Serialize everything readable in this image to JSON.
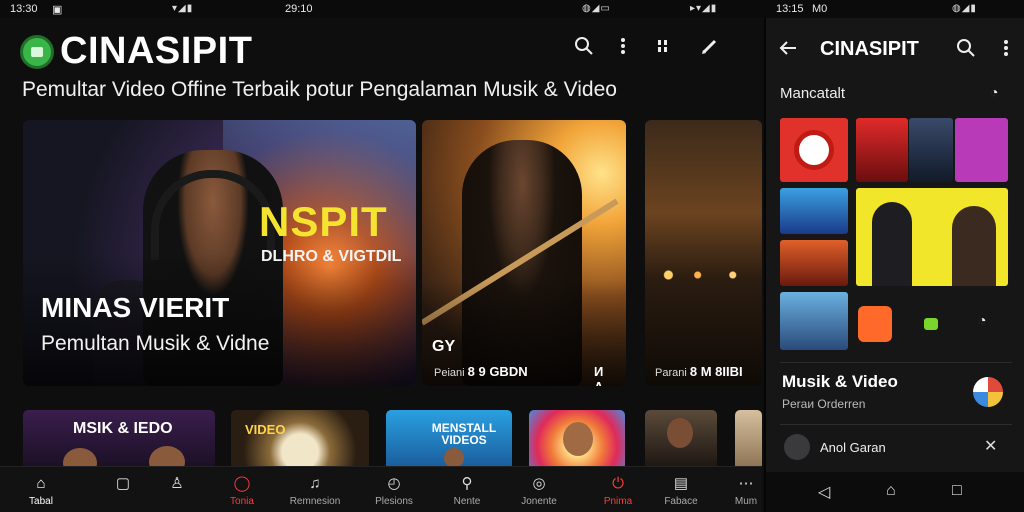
{
  "status_bar": {
    "left_time": "13:30",
    "mid_time": "29:10",
    "right_time": "13:15",
    "right_label": "M0"
  },
  "header": {
    "app_name": "CINASIPIT",
    "subtitle": "Pemultar Video Offine Terbaik potur Pengalaman Musik & Video",
    "icons": [
      "search-icon",
      "more-vert-icon",
      "grid-icon",
      "edit-icon"
    ]
  },
  "featured": [
    {
      "overlay_big": "NSPIT",
      "overlay_small": "DLHRO & VIGTDIL",
      "title": "MINAS VIERIT",
      "subtitle": "Pemultan Musik & Vidne"
    },
    {
      "tag": "GY",
      "foot_label": "Peiani",
      "foot_bold": "8 9 GBDN",
      "foot_right": "И A"
    },
    {
      "foot_label": "Parani",
      "foot_bold": "8 M 8IIBI"
    }
  ],
  "thumbnails": [
    {
      "label": "MSIK & IEDO"
    },
    {
      "label": "VIDEO"
    },
    {
      "label": "MENSTALL VIDEOS"
    },
    {
      "label": ""
    },
    {
      "label": ""
    },
    {
      "label": ""
    }
  ],
  "bottom_nav": [
    {
      "label": "Tabal",
      "icon": "home-icon",
      "state": "active"
    },
    {
      "label": "",
      "icon": "chat-icon",
      "state": "normal"
    },
    {
      "label": "",
      "icon": "profile-icon",
      "state": "normal"
    },
    {
      "label": "Tonia",
      "icon": "search-icon",
      "state": "red"
    },
    {
      "label": "Remnesion",
      "icon": "music-icon",
      "state": "normal"
    },
    {
      "label": "Plesions",
      "icon": "clock-icon",
      "state": "normal"
    },
    {
      "label": "Nente",
      "icon": "search-icon",
      "state": "normal"
    },
    {
      "label": "Jonente",
      "icon": "disc-icon",
      "state": "normal"
    },
    {
      "label": "Pnima",
      "icon": "power-icon",
      "state": "red"
    },
    {
      "label": "Fabace",
      "icon": "folder-icon",
      "state": "normal"
    },
    {
      "label": "Mum",
      "icon": "more-icon",
      "state": "normal"
    }
  ],
  "right_panel": {
    "title": "CINASIPIT",
    "section": "Mancatalt",
    "row_title": "Musik & Video",
    "row_subtitle": "Peraи Orderren",
    "player_name": "Anol Garan"
  },
  "colors": {
    "background": "#0e0e0f",
    "accent_red": "#ff3b3b",
    "logo_green": "#3bb54a",
    "hero_yellow": "#f4e430"
  }
}
